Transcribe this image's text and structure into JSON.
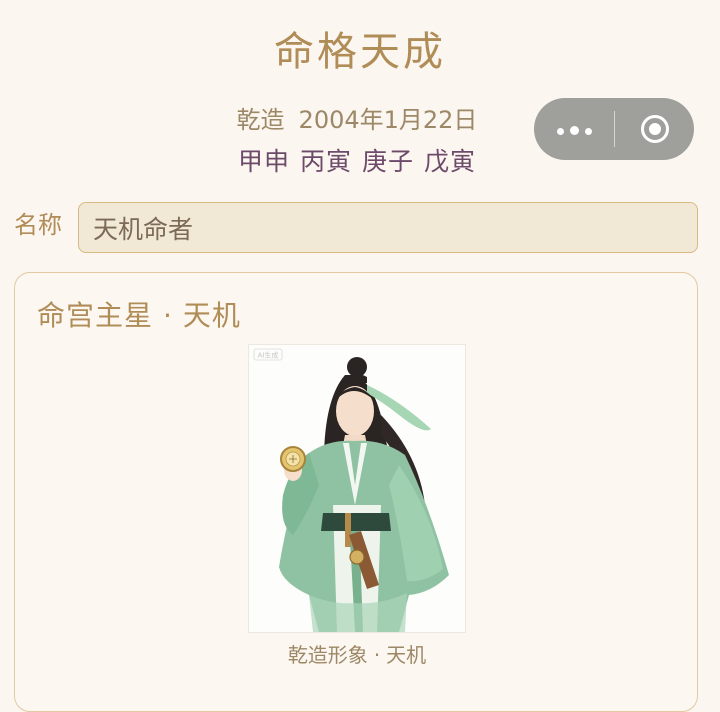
{
  "header": {
    "title": "命格天成",
    "gender": "乾造",
    "birth_date": "2004年1月22日",
    "pillars": [
      "甲申",
      "丙寅",
      "庚子",
      "戊寅"
    ]
  },
  "capsule": {
    "more_icon": "more-dots-icon",
    "close_icon": "target-ring-icon"
  },
  "name_field": {
    "label": "名称",
    "value": "天机命者"
  },
  "card": {
    "title_prefix": "命宫主星",
    "separator": "·",
    "star": "天机",
    "image_caption_prefix": "乾造形象",
    "image_caption_star": "天机",
    "watermark": "AI生成"
  },
  "colors": {
    "background": "#fbf6ef",
    "accent_gold": "#b08c57",
    "pillar_purple": "#6d4a6a",
    "robe_green": "#8fc2a2"
  }
}
